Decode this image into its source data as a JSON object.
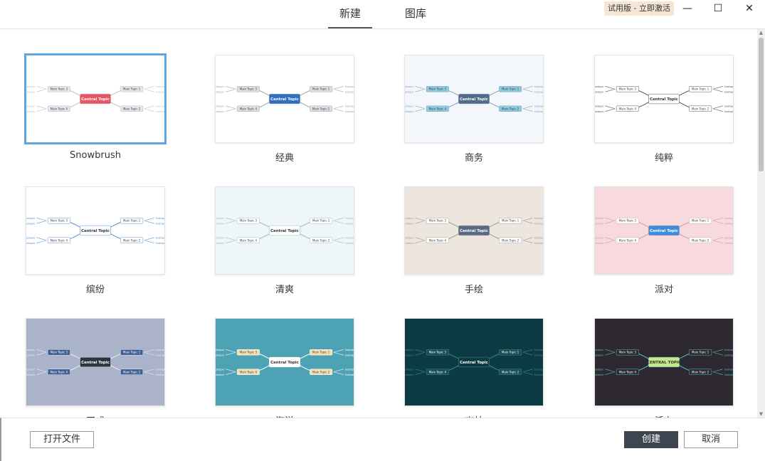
{
  "tabs": [
    {
      "label": "新建",
      "active": true
    },
    {
      "label": "图库",
      "active": false
    }
  ],
  "trial_badge": "试用版 - 立即激活",
  "window_controls": {
    "minimize": "—",
    "maximize": "☐",
    "close": "✕"
  },
  "templates": [
    {
      "name": "Snowbrush",
      "selected": true,
      "bg": "#ffffff",
      "central": "Central Topic",
      "central_color": "#e8545f",
      "central_text": "#ffffff",
      "topic_color": "#e3e6ea",
      "line": "#b9c0c9",
      "topics": [
        "Main Topic 1",
        "Main Topic 2",
        "Main Topic 3",
        "Main Topic 4"
      ]
    },
    {
      "name": "经典",
      "selected": false,
      "bg": "#ffffff",
      "central": "Central Topic",
      "central_color": "#2f6fbf",
      "central_text": "#ffffff",
      "topic_color": "#dddfe2",
      "line": "#9aa3ad",
      "topics": [
        "Main Topic 1",
        "Main Topic 2",
        "Main Topic 3",
        "Main Topic 4"
      ]
    },
    {
      "name": "商务",
      "selected": false,
      "bg": "#f3f7fb",
      "central": "Central Topic",
      "central_color": "#546a8a",
      "central_text": "#ffffff",
      "topic_color": "#8ccbe0",
      "line": "#8aa0b5",
      "topics": [
        "Main Topic 1",
        "Main Topic 2",
        "Main Topic 3",
        "Main Topic 4"
      ]
    },
    {
      "name": "纯粹",
      "selected": false,
      "bg": "#ffffff",
      "central": "Central Topic",
      "central_color": "#ffffff",
      "central_text": "#333333",
      "topic_color": "#ffffff",
      "line": "#555555",
      "topics": [
        "Main Topic 1",
        "Main Topic 2",
        "Main Topic 3",
        "Main Topic 4"
      ]
    },
    {
      "name": "缤纷",
      "selected": false,
      "bg": "#ffffff",
      "central": "Central Topic",
      "central_color": "#ffffff",
      "central_text": "#333333",
      "topic_color": "#ffffff",
      "line": "#5a8fd0",
      "topics": [
        "Main Topic 1",
        "Main Topic 2",
        "Main Topic 3",
        "Main Topic 4"
      ]
    },
    {
      "name": "清爽",
      "selected": false,
      "bg": "#eef6f9",
      "central": "Central Topic",
      "central_color": "#ffffff",
      "central_text": "#333333",
      "topic_color": "#ffffff",
      "line": "#9bb8c2",
      "topics": [
        "Main Topic 1",
        "Main Topic 2",
        "Main Topic 3",
        "Main Topic 4"
      ]
    },
    {
      "name": "手绘",
      "selected": false,
      "bg": "#ede6df",
      "central": "Central Topic",
      "central_color": "#5b6b85",
      "central_text": "#ffffff",
      "topic_color": "#ffffff",
      "line": "#a09a90",
      "topics": [
        "Main Topic 1",
        "Main Topic 2",
        "Main Topic 3",
        "Main Topic 4"
      ]
    },
    {
      "name": "派对",
      "selected": false,
      "bg": "#f7d9de",
      "central": "Central Topic",
      "central_color": "#3d8ddb",
      "central_text": "#ffffff",
      "topic_color": "#ffffff",
      "line": "#c7a0a8",
      "topics": [
        "Main Topic 1",
        "Main Topic 2",
        "Main Topic 3",
        "Main Topic 4"
      ]
    },
    {
      "name": "正式",
      "selected": false,
      "bg": "#aab3c9",
      "central": "Central Topic",
      "central_color": "#2e3440",
      "central_text": "#ffffff",
      "topic_color": "#3e5f94",
      "line": "#e9edf4",
      "topics": [
        "Main Topic 1",
        "Main Topic 2",
        "Main Topic 3",
        "Main Topic 4"
      ]
    },
    {
      "name": "海洋",
      "selected": false,
      "bg": "#4da2b4",
      "central": "Central Topic",
      "central_color": "#ffffff",
      "central_text": "#333333",
      "topic_color": "#f6dfb1",
      "line": "#ffffff",
      "topics": [
        "Main Topic 1",
        "Main Topic 2",
        "Main Topic 3",
        "Main Topic 4"
      ]
    },
    {
      "name": "幽林",
      "selected": false,
      "bg": "#0d3b44",
      "central": "Central Topic",
      "central_color": "#0d3b44",
      "central_text": "#ffffff",
      "topic_color": "#1a4e57",
      "line": "#3f8a8f",
      "topics": [
        "Main Topic 1",
        "Main Topic 2",
        "Main Topic 3",
        "Main Topic 4"
      ]
    },
    {
      "name": "活力",
      "selected": false,
      "bg": "#2e2830",
      "central": "CENTRAL TOPIC",
      "central_color": "#c8e68a",
      "central_text": "#333333",
      "topic_color": "#2e2830",
      "line": "#4fc3c9",
      "topics": [
        "Main Topic 1",
        "Main Topic 2",
        "Main Topic 3",
        "Main Topic 4"
      ]
    }
  ],
  "buttons": {
    "open_file": "打开文件",
    "create": "创建",
    "cancel": "取消"
  }
}
